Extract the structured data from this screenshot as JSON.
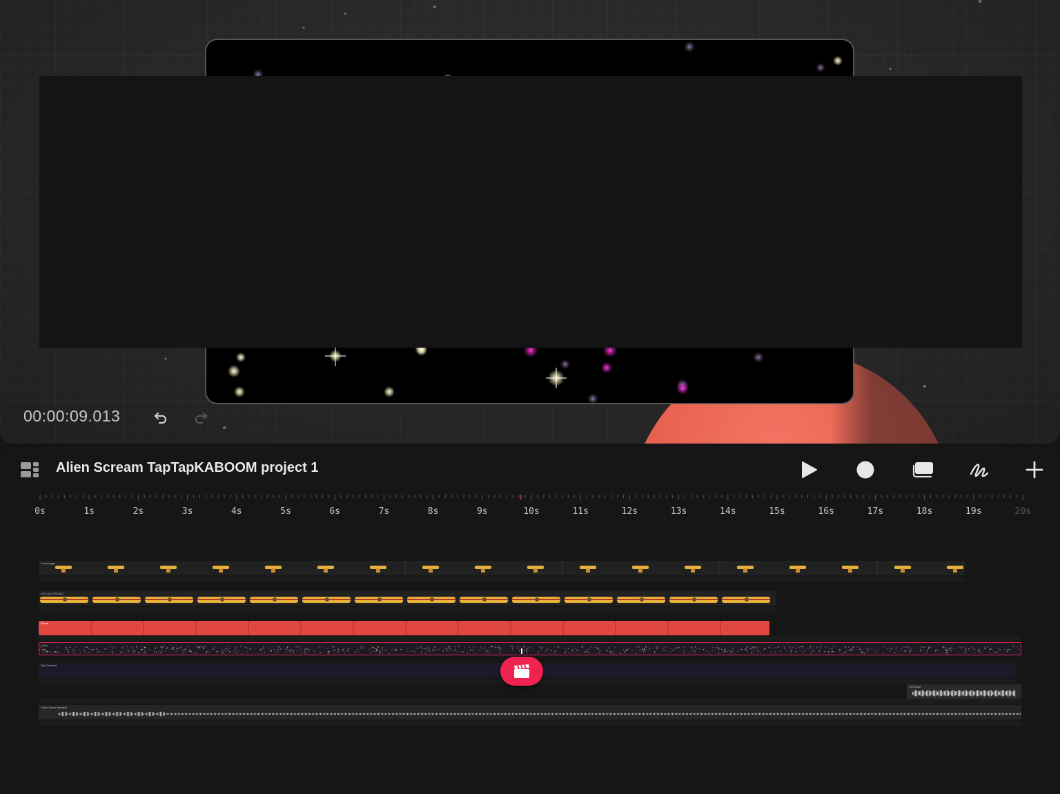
{
  "stage": {
    "timecode": "00:00:09.013"
  },
  "toolbar": {
    "project_title": "Alien Scream TapTapKABOOM project 1"
  },
  "ruler": {
    "labels": [
      "0s",
      "1s",
      "2s",
      "3s",
      "4s",
      "5s",
      "6s",
      "7s",
      "8s",
      "9s",
      "10s",
      "11s",
      "12s",
      "13s",
      "14s",
      "15s",
      "16s",
      "17s",
      "18s",
      "19s",
      "20s"
    ]
  },
  "tracks": [
    {
      "label": "Facehugger"
    },
    {
      "label": "USS NOSTROMO"
    },
    {
      "label": "Planet"
    },
    {
      "label": "Stars"
    },
    {
      "label": "Sky Gradient"
    },
    {
      "label": "SCREAM"
    },
    {
      "label": "Outer Space Ambient"
    }
  ],
  "colors": {
    "accent": "#ee2350",
    "planet": "#e8604f",
    "ship": "#e7b13a"
  },
  "icons": [
    "layout-icon",
    "undo-icon",
    "redo-icon",
    "play-icon",
    "record-dot-icon",
    "layers-icon",
    "draw-icon",
    "add-icon",
    "clapperboard-icon"
  ]
}
